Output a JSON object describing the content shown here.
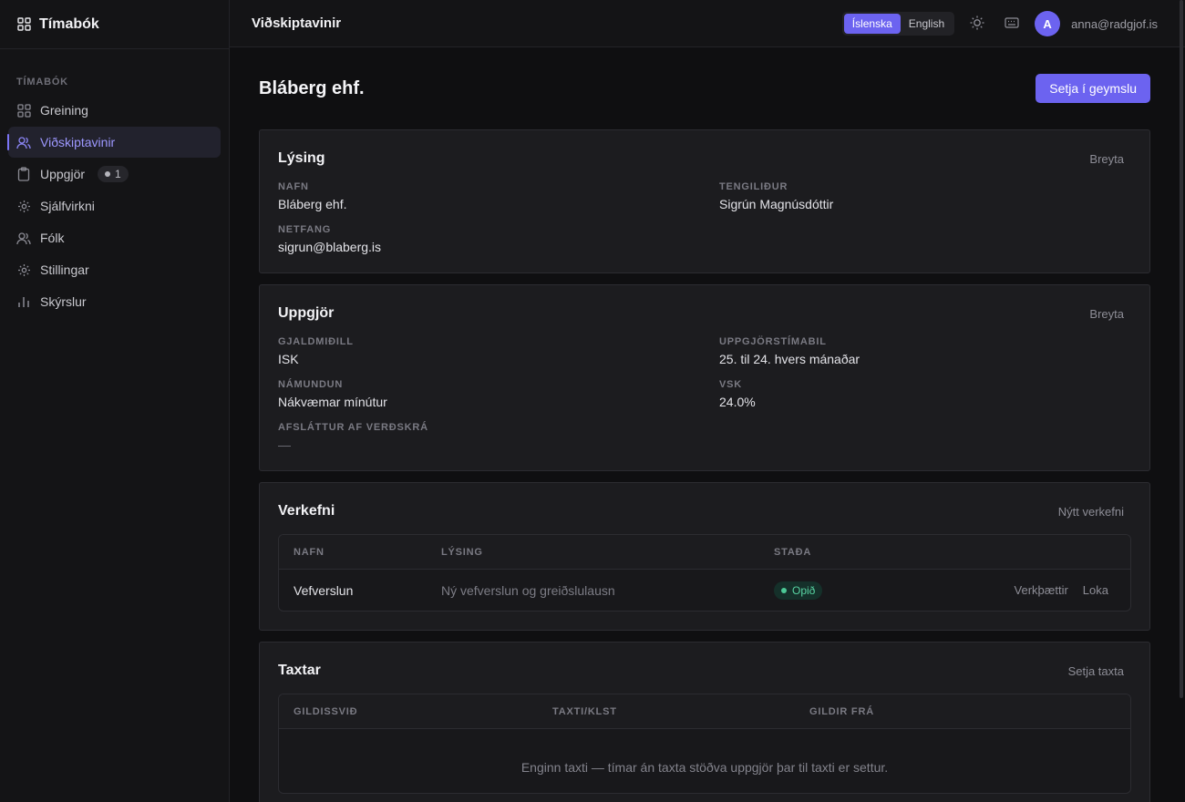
{
  "app": {
    "name": "Tímabók",
    "icons": {
      "brand": "grid-icon"
    }
  },
  "sidebar": {
    "section_label": "TÍMABÓK",
    "items": [
      {
        "label": "Greining",
        "icon": "grid-icon"
      },
      {
        "label": "Viðskiptavinir",
        "icon": "users-icon",
        "active": true
      },
      {
        "label": "Uppgjör",
        "icon": "clipboard-icon",
        "badge": "1"
      },
      {
        "label": "Sjálfvirkni",
        "icon": "gear-icon"
      },
      {
        "label": "Fólk",
        "icon": "users-icon"
      },
      {
        "label": "Stillingar",
        "icon": "gear-icon"
      },
      {
        "label": "Skýrslur",
        "icon": "bar-chart-icon"
      }
    ]
  },
  "topbar": {
    "title": "Viðskiptavinir",
    "languages": [
      "Íslenska",
      "English"
    ],
    "selected_language": "Íslenska",
    "avatar_initial": "A",
    "user_email": "anna@radgjof.is"
  },
  "page": {
    "title": "Bláberg ehf.",
    "archive_button": "Setja í geymslu"
  },
  "description_card": {
    "title": "Lýsing",
    "action": "Breyta",
    "fields": [
      {
        "label": "NAFN",
        "value": "Bláberg ehf."
      },
      {
        "label": "TENGILIÐUR",
        "value": "Sigrún Magnúsdóttir"
      },
      {
        "label": "NETFANG",
        "value": "sigrun@blaberg.is"
      }
    ]
  },
  "billing_card": {
    "title": "Uppgjör",
    "action": "Breyta",
    "fields": [
      {
        "label": "GJALDMIÐILL",
        "value": "ISK"
      },
      {
        "label": "UPPGJÖRSTÍMABIL",
        "value": "25. til 24. hvers mánaðar"
      },
      {
        "label": "NÁMUNDUN",
        "value": "Nákvæmar mínútur"
      },
      {
        "label": "VSK",
        "value": "24.0%"
      },
      {
        "label": "AFSLÁTTUR AF VERÐSKRÁ",
        "value": "—"
      }
    ]
  },
  "projects_card": {
    "title": "Verkefni",
    "action": "Nýtt verkefni",
    "columns": [
      "NAFN",
      "LÝSING",
      "STAÐA"
    ],
    "rows": [
      {
        "name": "Vefverslun",
        "description": "Ný vefverslun og greiðslulausn",
        "status": "Opið",
        "actions": [
          "Verkþættir",
          "Loka"
        ]
      }
    ]
  },
  "rates_card": {
    "title": "Taxtar",
    "action": "Setja taxta",
    "columns": [
      "GILDISSVIÐ",
      "TAXTI/KLST",
      "GILDIR FRÁ"
    ],
    "empty_text": "Enginn taxti — tímar án taxta stöðva uppgjör þar til taxti er settur."
  },
  "colors": {
    "accent": "#6c63f0",
    "status_open": "#58d3a2",
    "background": "#0f0f11",
    "card": "#1c1c1f"
  }
}
